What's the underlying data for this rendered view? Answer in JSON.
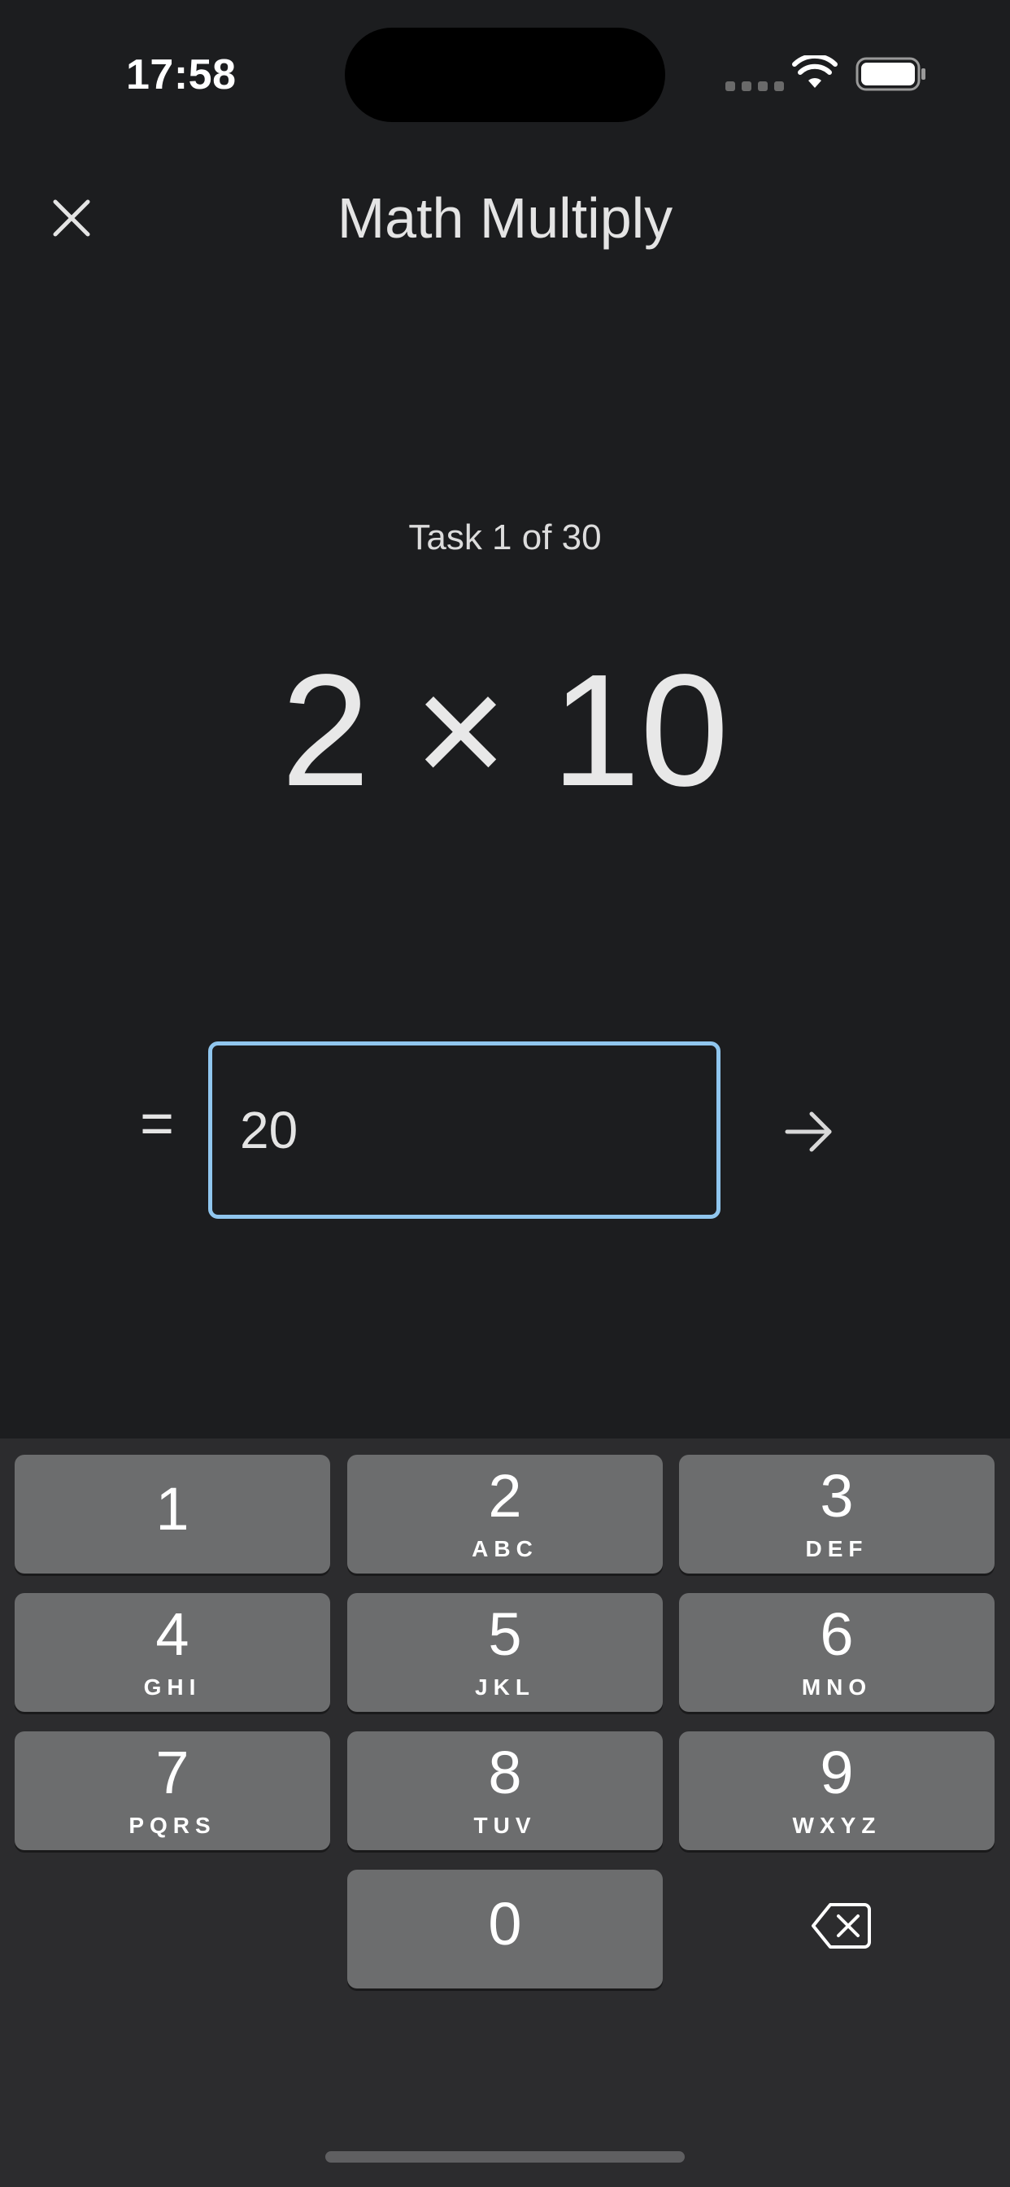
{
  "status_bar": {
    "time": "17:58"
  },
  "header": {
    "title": "Math Multiply",
    "close_icon": "close-icon"
  },
  "task": {
    "progress_label": "Task 1 of 30",
    "problem": "2 × 10"
  },
  "answer": {
    "equals": "=",
    "value": "20",
    "submit_icon": "arrow-right-icon"
  },
  "keyboard": {
    "keys": [
      {
        "digit": "1",
        "letters": ""
      },
      {
        "digit": "2",
        "letters": "ABC"
      },
      {
        "digit": "3",
        "letters": "DEF"
      },
      {
        "digit": "4",
        "letters": "GHI"
      },
      {
        "digit": "5",
        "letters": "JKL"
      },
      {
        "digit": "6",
        "letters": "MNO"
      },
      {
        "digit": "7",
        "letters": "PQRS"
      },
      {
        "digit": "8",
        "letters": "TUV"
      },
      {
        "digit": "9",
        "letters": "WXYZ"
      },
      {
        "digit": "0",
        "letters": ""
      }
    ],
    "delete_icon": "backspace-icon"
  },
  "colors": {
    "background": "#1c1d1f",
    "input_border": "#90c6ee",
    "key_background": "#6c6d6e",
    "keyboard_background": "#2c2c2e"
  }
}
